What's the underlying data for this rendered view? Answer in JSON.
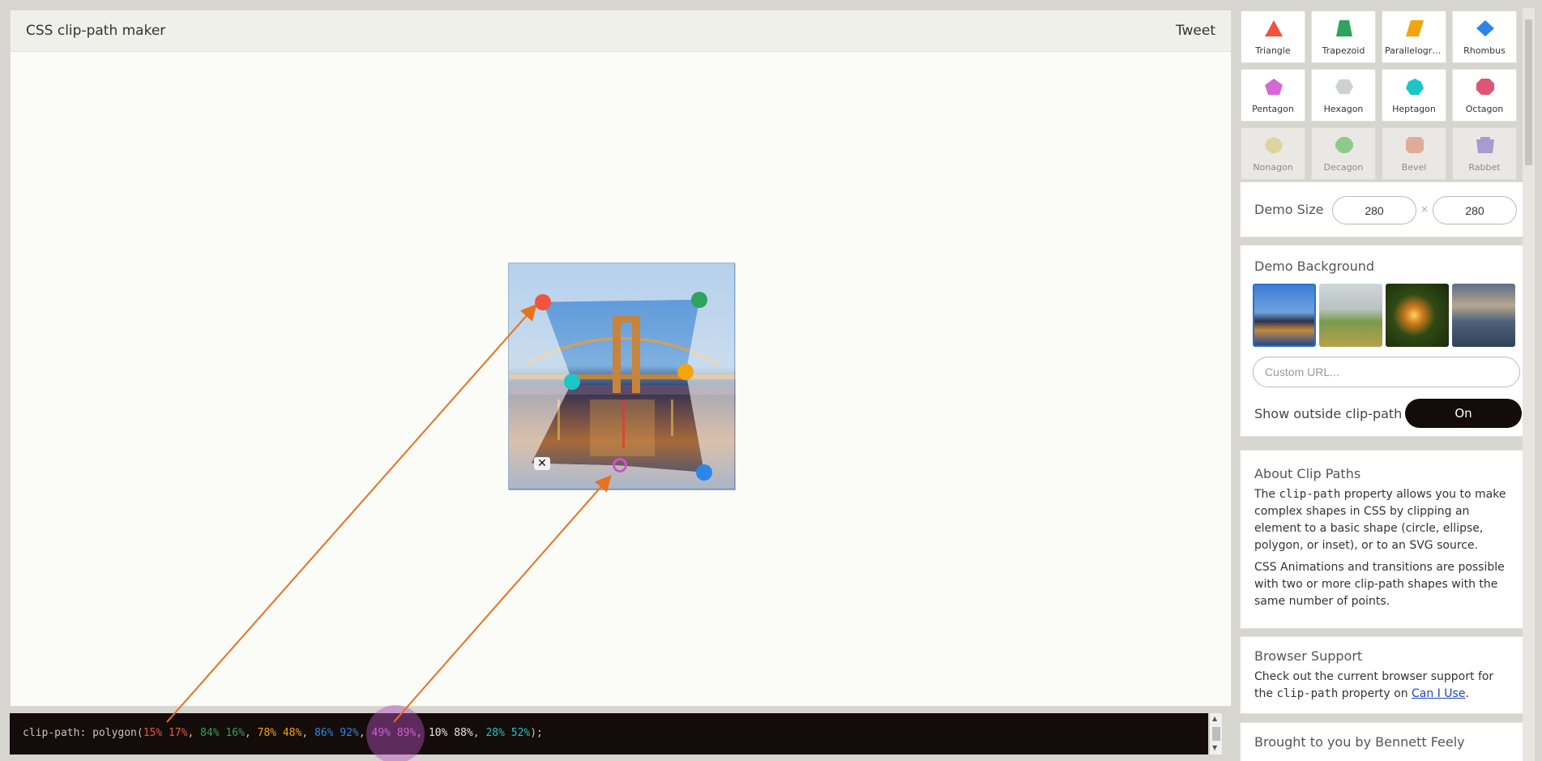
{
  "header": {
    "title": "CSS clip-path maker",
    "tweet_label": "Tweet"
  },
  "demo": {
    "points": [
      {
        "x": 15,
        "y": 17,
        "color": "#f0533e"
      },
      {
        "x": 84,
        "y": 16,
        "color": "#2ea35e"
      },
      {
        "x": 78,
        "y": 48,
        "color": "#f4a40e"
      },
      {
        "x": 86,
        "y": 92,
        "color": "#2b86e8"
      },
      {
        "x": 49,
        "y": 89,
        "color": "#cc55cc",
        "hollow": true
      },
      {
        "x": 10,
        "y": 88,
        "color": "#ffffff"
      },
      {
        "x": 28,
        "y": 52,
        "color": "#1cc6c6"
      }
    ],
    "delete_label": "✕"
  },
  "code": {
    "prefix": "clip-path: polygon(",
    "suffix": ");",
    "parts": [
      {
        "text": "15% 17%",
        "color": "#f0533e"
      },
      {
        "text": "84% 16%",
        "color": "#2ea35e"
      },
      {
        "text": "78% 48%",
        "color": "#f4a40e"
      },
      {
        "text": "86% 92%",
        "color": "#2b86e8"
      },
      {
        "text": "49% 89%",
        "color": "#e56ee5"
      },
      {
        "text": "10% 88%",
        "color": "#e8e2da"
      },
      {
        "text": "28% 52%",
        "color": "#1cc6c6"
      }
    ]
  },
  "shapes": [
    {
      "label": "Triangle",
      "color": "#f0533e",
      "icon": "triangle-icon"
    },
    {
      "label": "Trapezoid",
      "color": "#2ea35e",
      "icon": "trapezoid-icon"
    },
    {
      "label": "Parallelogram",
      "color": "#f4a40e",
      "icon": "parallelogram-icon"
    },
    {
      "label": "Rhombus",
      "color": "#2b86e8",
      "icon": "rhombus-icon"
    },
    {
      "label": "Pentagon",
      "color": "#d668d6",
      "icon": "pentagon-icon"
    },
    {
      "label": "Hexagon",
      "color": "#cfd0d1",
      "icon": "hexagon-icon"
    },
    {
      "label": "Heptagon",
      "color": "#1cc6c6",
      "icon": "heptagon-icon"
    },
    {
      "label": "Octagon",
      "color": "#dd5577",
      "icon": "octagon-icon"
    },
    {
      "label": "Nonagon",
      "color": "#e6d36a",
      "icon": "nonagon-icon"
    },
    {
      "label": "Decagon",
      "color": "#3cbb3c",
      "icon": "decagon-icon"
    },
    {
      "label": "Bevel",
      "color": "#f07a55",
      "icon": "bevel-icon"
    },
    {
      "label": "Rabbet",
      "color": "#6a5ac8",
      "icon": "rabbet-icon"
    }
  ],
  "demo_size": {
    "label": "Demo Size",
    "width": "280",
    "height": "280",
    "times": "×"
  },
  "demo_background": {
    "label": "Demo Background",
    "thumbnails": [
      "bridge",
      "landscape",
      "sparkler",
      "ocean"
    ],
    "custom_url_placeholder": "Custom URL...",
    "outside_label": "Show outside clip-path",
    "toggle_label": "On"
  },
  "about": {
    "title": "About Clip Paths",
    "p1_before": "The ",
    "p1_code": "clip-path",
    "p1_after": " property allows you to make complex shapes in CSS by clipping an element to a basic shape (circle, ellipse, polygon, or inset), or to an SVG source.",
    "p2": "CSS Animations and transitions are possible with two or more clip-path shapes with the same number of points."
  },
  "support": {
    "title": "Browser Support",
    "text_before": "Check out the current browser support for the ",
    "code": "clip-path",
    "text_mid": " property on ",
    "link": "Can I Use",
    "text_after": "."
  },
  "credit": {
    "title": "Brought to you by Bennett Feely"
  }
}
